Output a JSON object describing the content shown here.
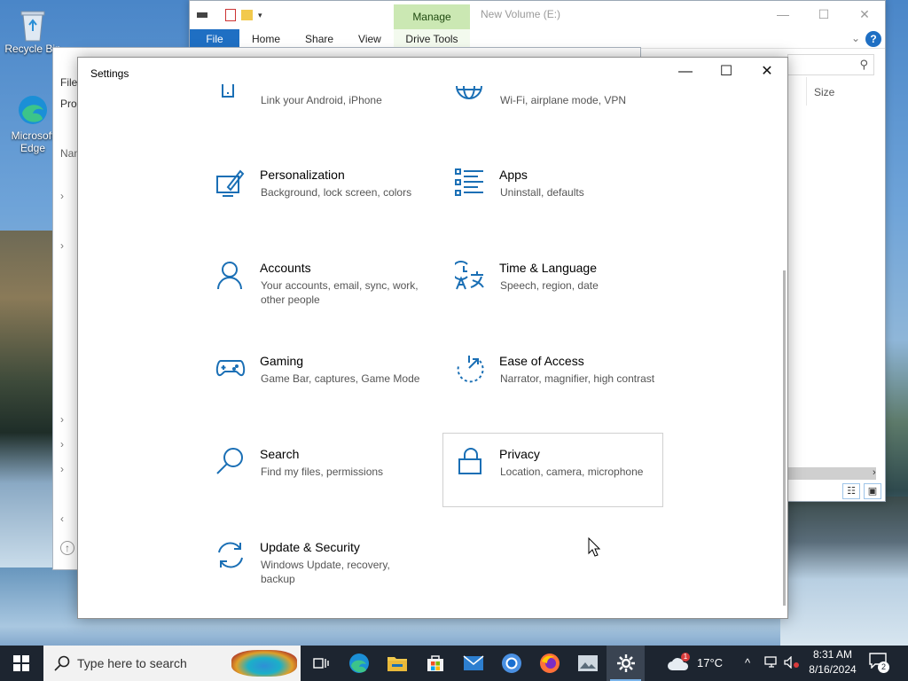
{
  "desktop": {
    "icons": [
      {
        "label": "Recycle Bin"
      },
      {
        "label": "Microsoft Edge"
      }
    ]
  },
  "explorer": {
    "manage_tab": "Manage",
    "title": "New Volume (E:)",
    "tabs": [
      "File",
      "Home",
      "Share",
      "View"
    ],
    "drive_tools": "Drive Tools",
    "help": "?",
    "size_column": "Size"
  },
  "bg_window": {
    "file_label": "File",
    "pro_label": "Pro",
    "name_label": "Nam"
  },
  "settings": {
    "title": "Settings",
    "tiles": [
      {
        "name": "",
        "desc": "Link your Android, iPhone",
        "icon": "phone-icon"
      },
      {
        "name": "",
        "desc": "Wi-Fi, airplane mode, VPN",
        "icon": "globe-icon"
      },
      {
        "name": "Personalization",
        "desc": "Background, lock screen, colors",
        "icon": "personalization-icon"
      },
      {
        "name": "Apps",
        "desc": "Uninstall, defaults",
        "icon": "apps-icon"
      },
      {
        "name": "Accounts",
        "desc": "Your accounts, email, sync, work, other people",
        "icon": "accounts-icon"
      },
      {
        "name": "Time & Language",
        "desc": "Speech, region, date",
        "icon": "time-language-icon"
      },
      {
        "name": "Gaming",
        "desc": "Game Bar, captures, Game Mode",
        "icon": "gaming-icon"
      },
      {
        "name": "Ease of Access",
        "desc": "Narrator, magnifier, high contrast",
        "icon": "ease-of-access-icon"
      },
      {
        "name": "Search",
        "desc": "Find my files, permissions",
        "icon": "search-icon"
      },
      {
        "name": "Privacy",
        "desc": "Location, camera, microphone",
        "icon": "lock-icon"
      },
      {
        "name": "Update & Security",
        "desc": "Windows Update, recovery, backup",
        "icon": "update-icon"
      }
    ],
    "accent": "#1a6fb5"
  },
  "taskbar": {
    "search_placeholder": "Type here to search",
    "weather": "17°C",
    "mail_badge": "1",
    "time": "8:31 AM",
    "date": "8/16/2024",
    "notifications_count": "2",
    "apps": [
      "task-view-icon",
      "edge-icon",
      "file-explorer-icon",
      "store-icon",
      "mail-icon",
      "chrome-icon",
      "firefox-icon",
      "photos-icon",
      "settings-icon"
    ]
  }
}
